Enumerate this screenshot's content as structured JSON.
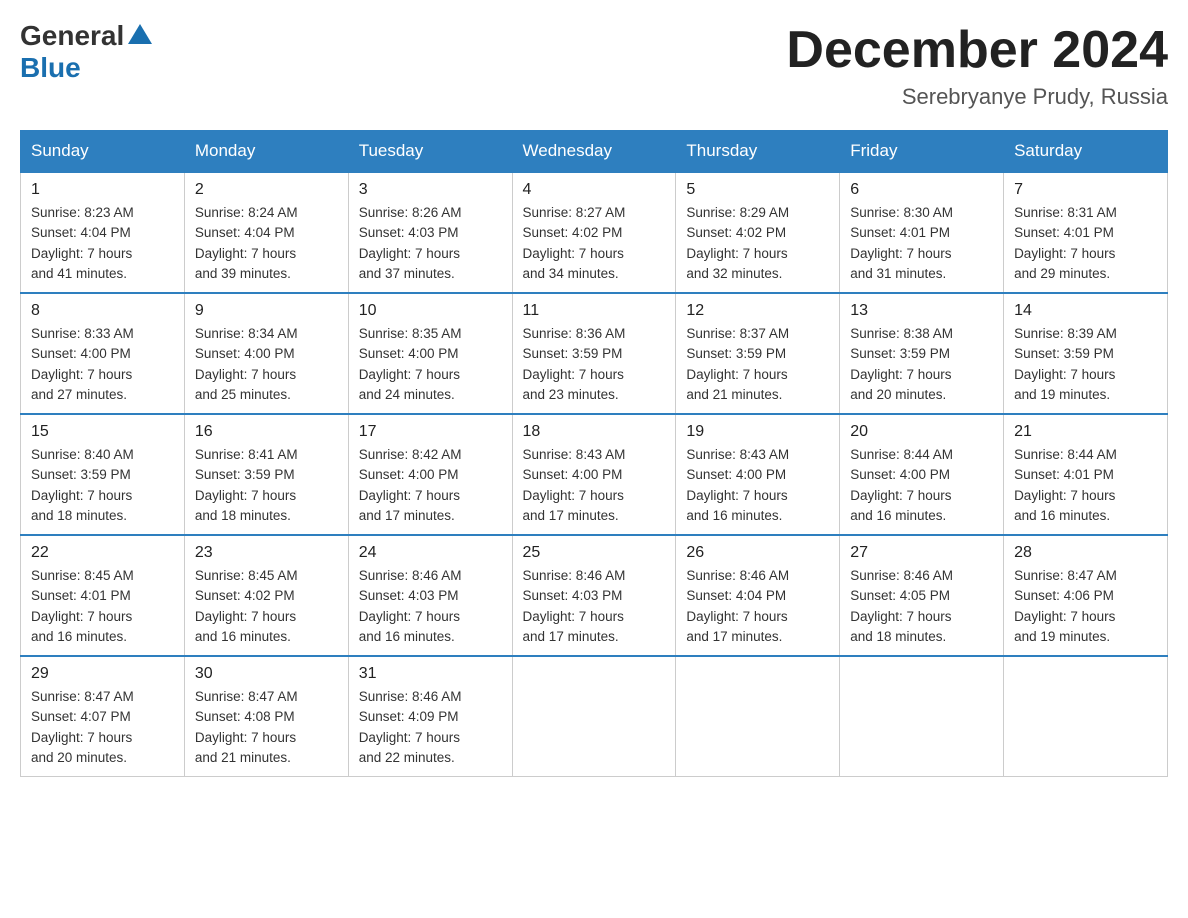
{
  "header": {
    "logo_general": "General",
    "logo_blue": "Blue",
    "month_title": "December 2024",
    "location": "Serebryanye Prudy, Russia"
  },
  "weekdays": [
    "Sunday",
    "Monday",
    "Tuesday",
    "Wednesday",
    "Thursday",
    "Friday",
    "Saturday"
  ],
  "weeks": [
    [
      {
        "day": "1",
        "sunrise": "8:23 AM",
        "sunset": "4:04 PM",
        "daylight": "7 hours and 41 minutes."
      },
      {
        "day": "2",
        "sunrise": "8:24 AM",
        "sunset": "4:04 PM",
        "daylight": "7 hours and 39 minutes."
      },
      {
        "day": "3",
        "sunrise": "8:26 AM",
        "sunset": "4:03 PM",
        "daylight": "7 hours and 37 minutes."
      },
      {
        "day": "4",
        "sunrise": "8:27 AM",
        "sunset": "4:02 PM",
        "daylight": "7 hours and 34 minutes."
      },
      {
        "day": "5",
        "sunrise": "8:29 AM",
        "sunset": "4:02 PM",
        "daylight": "7 hours and 32 minutes."
      },
      {
        "day": "6",
        "sunrise": "8:30 AM",
        "sunset": "4:01 PM",
        "daylight": "7 hours and 31 minutes."
      },
      {
        "day": "7",
        "sunrise": "8:31 AM",
        "sunset": "4:01 PM",
        "daylight": "7 hours and 29 minutes."
      }
    ],
    [
      {
        "day": "8",
        "sunrise": "8:33 AM",
        "sunset": "4:00 PM",
        "daylight": "7 hours and 27 minutes."
      },
      {
        "day": "9",
        "sunrise": "8:34 AM",
        "sunset": "4:00 PM",
        "daylight": "7 hours and 25 minutes."
      },
      {
        "day": "10",
        "sunrise": "8:35 AM",
        "sunset": "4:00 PM",
        "daylight": "7 hours and 24 minutes."
      },
      {
        "day": "11",
        "sunrise": "8:36 AM",
        "sunset": "3:59 PM",
        "daylight": "7 hours and 23 minutes."
      },
      {
        "day": "12",
        "sunrise": "8:37 AM",
        "sunset": "3:59 PM",
        "daylight": "7 hours and 21 minutes."
      },
      {
        "day": "13",
        "sunrise": "8:38 AM",
        "sunset": "3:59 PM",
        "daylight": "7 hours and 20 minutes."
      },
      {
        "day": "14",
        "sunrise": "8:39 AM",
        "sunset": "3:59 PM",
        "daylight": "7 hours and 19 minutes."
      }
    ],
    [
      {
        "day": "15",
        "sunrise": "8:40 AM",
        "sunset": "3:59 PM",
        "daylight": "7 hours and 18 minutes."
      },
      {
        "day": "16",
        "sunrise": "8:41 AM",
        "sunset": "3:59 PM",
        "daylight": "7 hours and 18 minutes."
      },
      {
        "day": "17",
        "sunrise": "8:42 AM",
        "sunset": "4:00 PM",
        "daylight": "7 hours and 17 minutes."
      },
      {
        "day": "18",
        "sunrise": "8:43 AM",
        "sunset": "4:00 PM",
        "daylight": "7 hours and 17 minutes."
      },
      {
        "day": "19",
        "sunrise": "8:43 AM",
        "sunset": "4:00 PM",
        "daylight": "7 hours and 16 minutes."
      },
      {
        "day": "20",
        "sunrise": "8:44 AM",
        "sunset": "4:00 PM",
        "daylight": "7 hours and 16 minutes."
      },
      {
        "day": "21",
        "sunrise": "8:44 AM",
        "sunset": "4:01 PM",
        "daylight": "7 hours and 16 minutes."
      }
    ],
    [
      {
        "day": "22",
        "sunrise": "8:45 AM",
        "sunset": "4:01 PM",
        "daylight": "7 hours and 16 minutes."
      },
      {
        "day": "23",
        "sunrise": "8:45 AM",
        "sunset": "4:02 PM",
        "daylight": "7 hours and 16 minutes."
      },
      {
        "day": "24",
        "sunrise": "8:46 AM",
        "sunset": "4:03 PM",
        "daylight": "7 hours and 16 minutes."
      },
      {
        "day": "25",
        "sunrise": "8:46 AM",
        "sunset": "4:03 PM",
        "daylight": "7 hours and 17 minutes."
      },
      {
        "day": "26",
        "sunrise": "8:46 AM",
        "sunset": "4:04 PM",
        "daylight": "7 hours and 17 minutes."
      },
      {
        "day": "27",
        "sunrise": "8:46 AM",
        "sunset": "4:05 PM",
        "daylight": "7 hours and 18 minutes."
      },
      {
        "day": "28",
        "sunrise": "8:47 AM",
        "sunset": "4:06 PM",
        "daylight": "7 hours and 19 minutes."
      }
    ],
    [
      {
        "day": "29",
        "sunrise": "8:47 AM",
        "sunset": "4:07 PM",
        "daylight": "7 hours and 20 minutes."
      },
      {
        "day": "30",
        "sunrise": "8:47 AM",
        "sunset": "4:08 PM",
        "daylight": "7 hours and 21 minutes."
      },
      {
        "day": "31",
        "sunrise": "8:46 AM",
        "sunset": "4:09 PM",
        "daylight": "7 hours and 22 minutes."
      },
      null,
      null,
      null,
      null
    ]
  ],
  "labels": {
    "sunrise": "Sunrise:",
    "sunset": "Sunset:",
    "daylight": "Daylight:"
  }
}
